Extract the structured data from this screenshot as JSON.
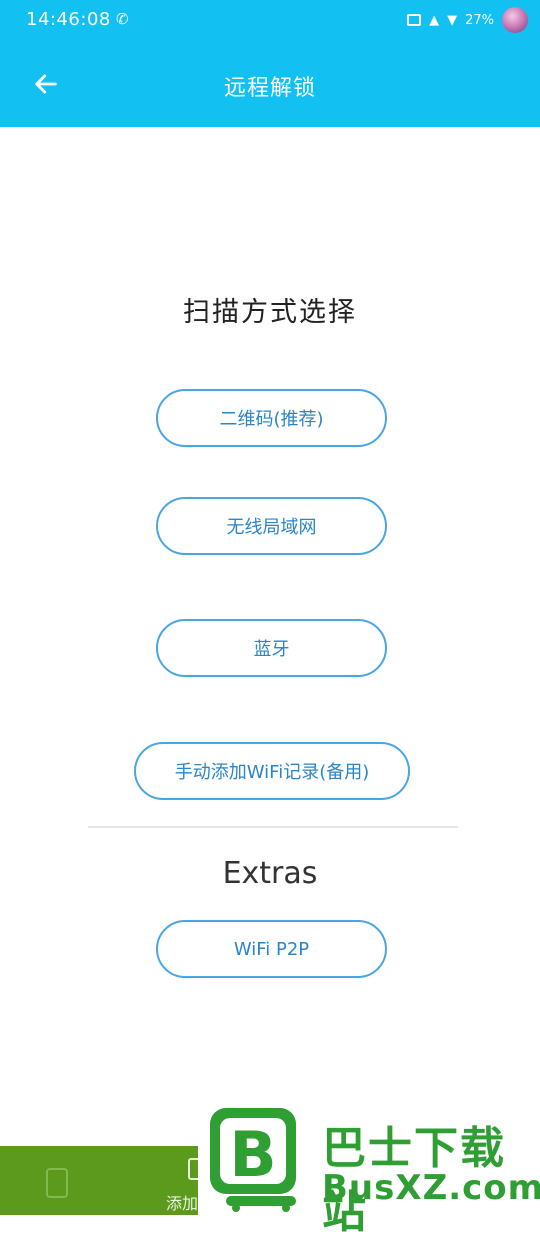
{
  "status_bar": {
    "time": "14:46:08",
    "battery": "27%",
    "icons": [
      "nfc-icon",
      "sim-icon",
      "signal-4g-icon",
      "wifi-icon",
      "avatar"
    ]
  },
  "app_bar": {
    "title": "远程解锁",
    "back_icon": "arrow-left-icon"
  },
  "scan": {
    "title": "扫描方式选择",
    "options": [
      "二维码(推荐)",
      "无线局域网",
      "蓝牙",
      "手动添加WiFi记录(备用)"
    ]
  },
  "extras": {
    "title": "Extras",
    "options": [
      "WiFi P2P"
    ]
  },
  "bottom_nav": {
    "partial_label": "添加"
  },
  "watermark": {
    "cn": "巴士下载站",
    "en": "BusXZ.com"
  },
  "colors": {
    "accent": "#12c0f2",
    "button_border": "#49a5e4",
    "button_text": "#2a86c9",
    "bottom_bar": "#5c9a1e",
    "watermark_green": "#2f9e33"
  }
}
